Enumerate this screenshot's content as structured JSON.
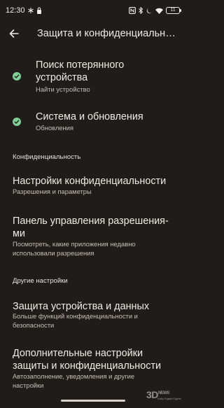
{
  "status_bar": {
    "time": "12:30",
    "battery": "11"
  },
  "app_bar": {
    "title": "Защита и конфиденциальность"
  },
  "items": [
    {
      "title": "Поиск потерянного устройства",
      "subtitle": "Найти устройство",
      "status": "ok"
    },
    {
      "title": "Система и обновления",
      "subtitle": "Обновления",
      "status": "ok"
    }
  ],
  "privacy": {
    "header": "Конфиденциальность",
    "items": [
      {
        "title": "Настройки конфиденциальности",
        "subtitle": "Разрешения и параметры"
      },
      {
        "title": "Панель управления разрешения-ми",
        "subtitle": "Посмотреть, какие приложения недавно использовали разрешения"
      }
    ]
  },
  "other": {
    "header": "Другие настройки",
    "items": [
      {
        "title": "Защита устройства и данных",
        "subtitle": "Больше функций конфиденциальности и безопасности"
      },
      {
        "title": "Дополнительные настройки защиты и конфиденциальности",
        "subtitle": "Автозаполнение, уведомления и другие настройки"
      }
    ]
  },
  "watermark": {
    "logo": "3D",
    "text": "NEWS",
    "tagline": "Daily Digital Digest"
  },
  "colors": {
    "background": "#1f1c19",
    "check": "#7fcf96"
  }
}
